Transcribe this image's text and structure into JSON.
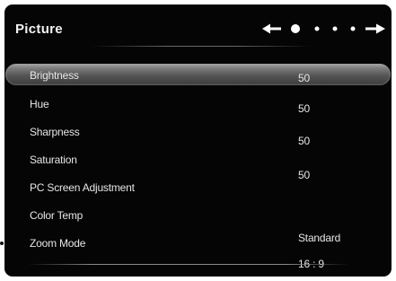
{
  "menu": {
    "title": "Picture",
    "items": [
      {
        "label": "Brightness",
        "value": "50"
      },
      {
        "label": "Hue",
        "value": "50"
      },
      {
        "label": "Sharpness",
        "value": "50"
      },
      {
        "label": "Saturation",
        "value": "50"
      },
      {
        "label": "PC Screen Adjustment",
        "value": ""
      },
      {
        "label": "Color Temp",
        "value": "Standard"
      },
      {
        "label": "Zoom Mode",
        "value": "16 : 9"
      }
    ],
    "selected_index": 0
  },
  "page_indicator": {
    "total_dots": 4,
    "current": 1,
    "left_icon": "arrow-left-icon",
    "right_icon": "arrow-right-icon"
  },
  "colors": {
    "background": "#050505",
    "text": "#e6e6e6",
    "highlight": "#7c7c7c"
  }
}
